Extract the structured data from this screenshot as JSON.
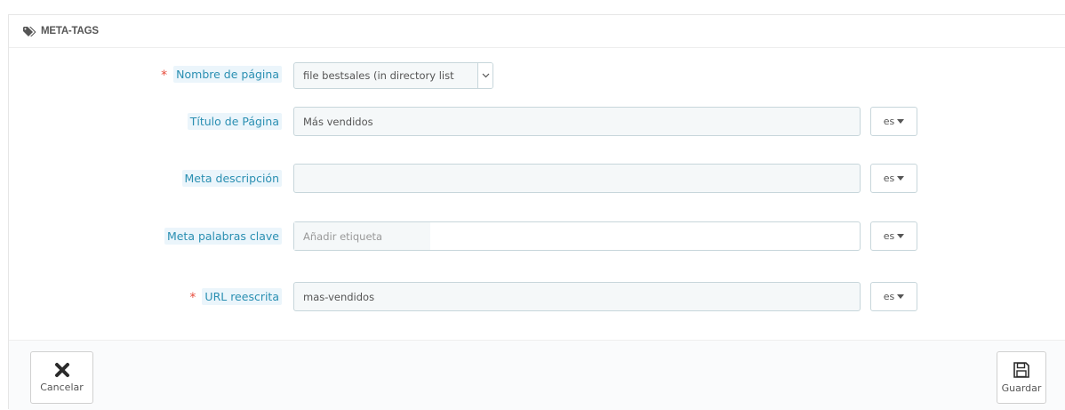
{
  "panel": {
    "title": "META-TAGS",
    "title_icon": "tags-icon"
  },
  "form": {
    "page_name": {
      "label": "Nombre de página",
      "required": "*",
      "value": "file bestsales (in directory list"
    },
    "page_title": {
      "label": "Título de Página",
      "value": "Más vendidos",
      "lang": "es"
    },
    "meta_description": {
      "label": "Meta descripción",
      "value": "",
      "lang": "es"
    },
    "meta_keywords": {
      "label": "Meta palabras clave",
      "placeholder": "Añadir etiqueta",
      "lang": "es"
    },
    "rewritten_url": {
      "label": "URL reescrita",
      "required": "*",
      "value": "mas-vendidos",
      "lang": "es"
    }
  },
  "footer": {
    "cancel_label": "Cancelar",
    "cancel_icon": "close-icon",
    "save_label": "Guardar",
    "save_icon": "save-icon"
  },
  "colors": {
    "label_text": "#2a8fb2",
    "label_bg": "#ebf5fb",
    "required": "#e74c3c",
    "input_border": "#c7d6db",
    "input_bg": "#f5f8f9"
  }
}
